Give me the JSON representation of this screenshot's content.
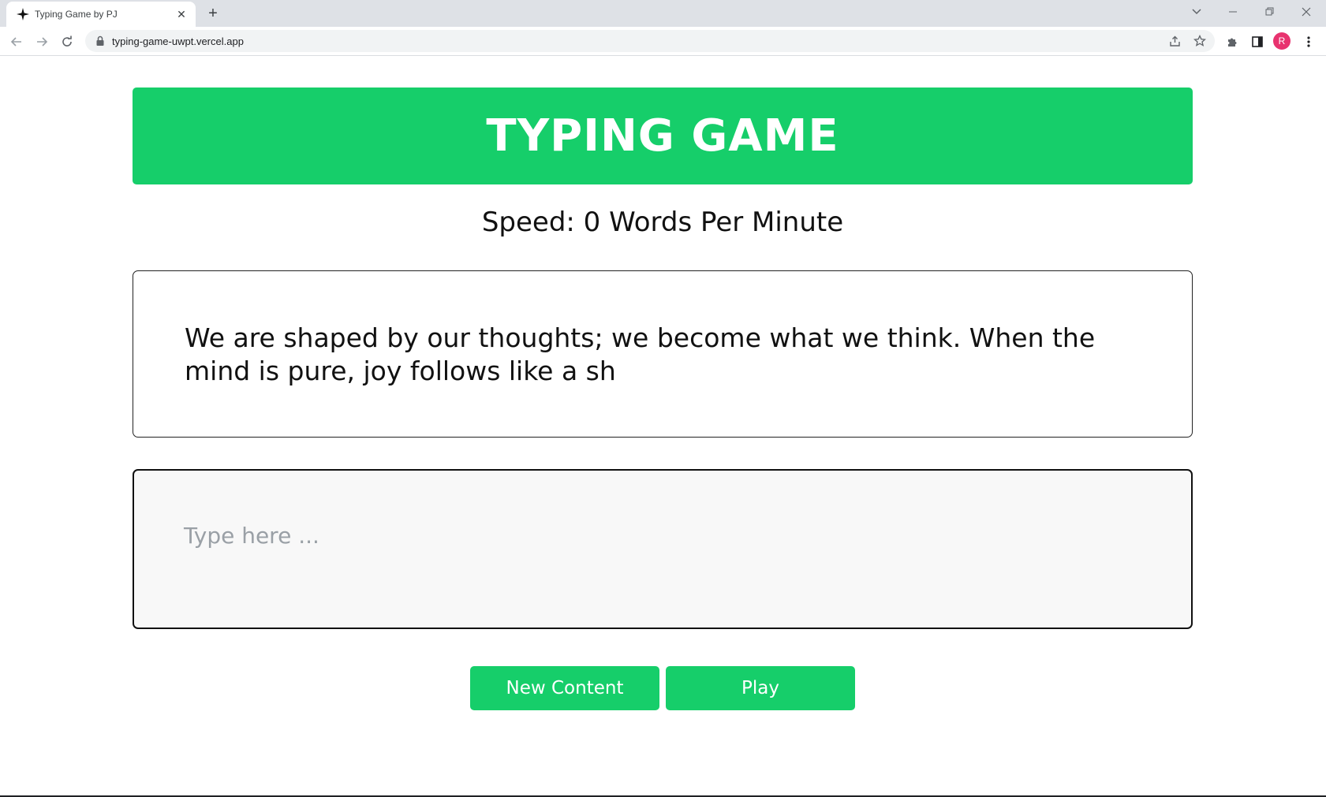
{
  "browser": {
    "tab_title": "Typing Game by PJ",
    "tab_close": "✕",
    "new_tab": "+",
    "url": "typing-game-uwpt.vercel.app",
    "profile_initial": "R",
    "profile_color": "#e8336f"
  },
  "app": {
    "title": "TYPING GAME",
    "speed_text": "Speed: 0 Words Per Minute",
    "quote": "We are shaped by our thoughts; we become what we think. When the mind is pure, joy follows like a sh",
    "input": {
      "value": "",
      "placeholder": "Type here ..."
    },
    "buttons": {
      "new_content": "New Content",
      "play": "Play"
    },
    "accent_color": "#16ce6a"
  }
}
